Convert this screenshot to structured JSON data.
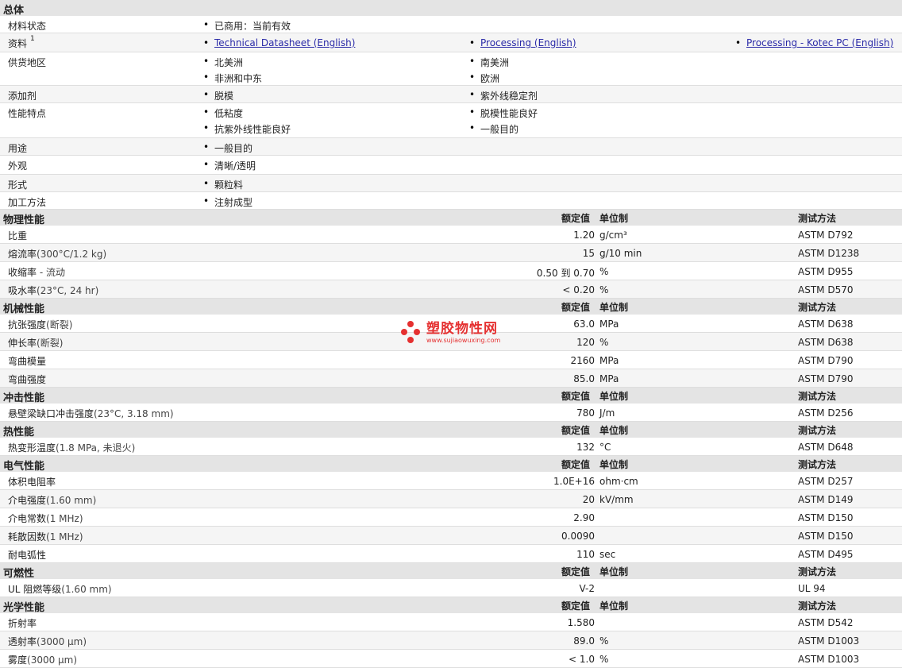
{
  "overview": {
    "title": "总体",
    "rows": [
      {
        "label": "材料状态",
        "items": [
          "已商用：当前有效"
        ]
      },
      {
        "label": "资料",
        "sup": "1",
        "links": [
          "Technical Datasheet (English)",
          "Processing (English)",
          "Processing - Kotec PC (English)"
        ]
      },
      {
        "label": "供货地区",
        "col1": [
          "北美洲",
          "非洲和中东"
        ],
        "col2": [
          "南美洲",
          "欧洲"
        ]
      },
      {
        "label": "添加剂",
        "col1": [
          "脱模"
        ],
        "col2": [
          "紫外线稳定剂"
        ]
      },
      {
        "label": "性能特点",
        "col1": [
          "低粘度",
          "抗紫外线性能良好"
        ],
        "col2": [
          "脱模性能良好",
          "一般目的"
        ]
      },
      {
        "label": "用途",
        "items": [
          "一般目的"
        ]
      },
      {
        "label": "外观",
        "items": [
          "清晰/透明"
        ]
      },
      {
        "label": "形式",
        "items": [
          "颗粒料"
        ]
      },
      {
        "label": "加工方法",
        "items": [
          "注射成型"
        ]
      }
    ]
  },
  "headers": {
    "value": "额定值",
    "unit": "单位制",
    "method": "测试方法"
  },
  "sections": [
    {
      "title": "物理性能",
      "rows": [
        {
          "label": "比重",
          "cond": "",
          "value": "1.20",
          "unit": "g/cm³",
          "method": "ASTM D792"
        },
        {
          "label": "熔流率",
          "cond": "(300°C/1.2 kg)",
          "value": "15",
          "unit": "g/10 min",
          "method": "ASTM D1238"
        },
        {
          "label": "收缩率",
          "cond": " - 流动",
          "value": "0.50 到  0.70",
          "unit": "%",
          "method": "ASTM D955"
        },
        {
          "label": "吸水率",
          "cond": "(23°C, 24 hr)",
          "value": "< 0.20",
          "unit": "%",
          "method": "ASTM D570"
        }
      ]
    },
    {
      "title": "机械性能",
      "rows": [
        {
          "label": "抗张强度",
          "cond": "(断裂)",
          "value": "63.0",
          "unit": "MPa",
          "method": "ASTM D638"
        },
        {
          "label": "伸长率",
          "cond": "(断裂)",
          "value": "120",
          "unit": "%",
          "method": "ASTM D638"
        },
        {
          "label": "弯曲模量",
          "cond": "",
          "value": "2160",
          "unit": "MPa",
          "method": "ASTM D790"
        },
        {
          "label": "弯曲强度",
          "cond": "",
          "value": "85.0",
          "unit": "MPa",
          "method": "ASTM D790"
        }
      ]
    },
    {
      "title": "冲击性能",
      "rows": [
        {
          "label": "悬壁梁缺口冲击强度",
          "cond": "(23°C, 3.18 mm)",
          "value": "780",
          "unit": "J/m",
          "method": "ASTM D256"
        }
      ]
    },
    {
      "title": "热性能",
      "rows": [
        {
          "label": "热变形温度",
          "cond": "(1.8 MPa, 未退火)",
          "value": "132",
          "unit": "°C",
          "method": "ASTM D648"
        }
      ]
    },
    {
      "title": "电气性能",
      "rows": [
        {
          "label": "体积电阻率",
          "cond": "",
          "value": "1.0E+16",
          "unit": "ohm·cm",
          "method": "ASTM D257"
        },
        {
          "label": "介电强度",
          "cond": "(1.60 mm)",
          "value": "20",
          "unit": "kV/mm",
          "method": "ASTM D149"
        },
        {
          "label": "介电常数",
          "cond": "(1 MHz)",
          "value": "2.90",
          "unit": "",
          "method": "ASTM D150"
        },
        {
          "label": "耗散因数",
          "cond": "(1 MHz)",
          "value": "0.0090",
          "unit": "",
          "method": "ASTM D150"
        },
        {
          "label": "耐电弧性",
          "cond": "",
          "value": "110",
          "unit": "sec",
          "method": "ASTM D495"
        }
      ]
    },
    {
      "title": "可燃性",
      "rows": [
        {
          "label": "UL 阻燃等级",
          "cond": "(1.60 mm)",
          "value": "V-2",
          "unit": "",
          "method": "UL 94"
        }
      ]
    },
    {
      "title": "光学性能",
      "rows": [
        {
          "label": "折射率",
          "cond": "",
          "value": "1.580",
          "unit": "",
          "method": "ASTM D542"
        },
        {
          "label": "透射率",
          "cond": "(3000 µm)",
          "value": "89.0",
          "unit": "%",
          "method": "ASTM D1003"
        },
        {
          "label": "雾度",
          "cond": "(3000 µm)",
          "value": "< 1.0",
          "unit": "%",
          "method": "ASTM D1003"
        }
      ]
    }
  ],
  "watermark": {
    "name": "塑胶物性网",
    "url": "www.sujiaowuxing.com"
  }
}
